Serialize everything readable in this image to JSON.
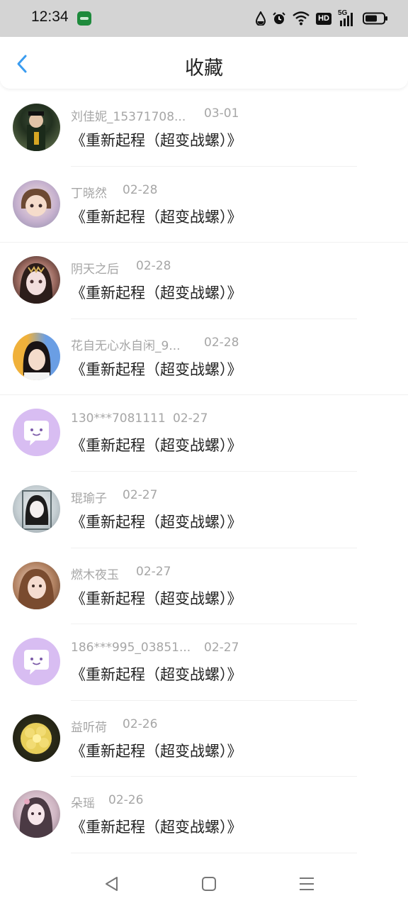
{
  "status_bar": {
    "time": "12:34",
    "icons": [
      "app-badge-icon",
      "data-drop-icon",
      "alarm-icon",
      "wifi-icon",
      "hd-icon",
      "5g-signal-icon",
      "battery-icon"
    ],
    "hd_label": "HD",
    "network_label": "5G"
  },
  "header": {
    "title": "收藏",
    "back_icon": "chevron-left-icon",
    "accent": "#3a9cf0"
  },
  "items": [
    {
      "name": "刘佳妮_15371708...",
      "date": "03-01",
      "title": "《重新起程（超变战螺）》",
      "avatar": "photo"
    },
    {
      "name": "丁晓然",
      "date": "02-28",
      "title": "《重新起程（超变战螺）》",
      "avatar": "photo"
    },
    {
      "name": "阴天之后",
      "date": "02-28",
      "title": "《重新起程（超变战螺）》",
      "avatar": "photo"
    },
    {
      "name": "花自无心水自闲_9...",
      "date": "02-28",
      "title": "《重新起程（超变战螺）》",
      "avatar": "photo"
    },
    {
      "name": "130***7081111",
      "date": "02-27",
      "title": "《重新起程（超变战螺）》",
      "avatar": "default"
    },
    {
      "name": "琨瑜子",
      "date": "02-27",
      "title": "《重新起程（超变战螺）》",
      "avatar": "photo"
    },
    {
      "name": "燃木夜玉",
      "date": "02-27",
      "title": "《重新起程（超变战螺）》",
      "avatar": "photo"
    },
    {
      "name": "186***995_03851...",
      "date": "02-27",
      "title": "《重新起程（超变战螺）》",
      "avatar": "default"
    },
    {
      "name": "益听荷",
      "date": "02-26",
      "title": "《重新起程（超变战螺）》",
      "avatar": "photo"
    },
    {
      "name": "朵瑶",
      "date": "02-26",
      "title": "《重新起程（超变战螺）》",
      "avatar": "photo"
    }
  ],
  "nav_bar": {
    "buttons": [
      "back-triangle-icon",
      "home-square-icon",
      "menu-lines-icon"
    ]
  },
  "colors": {
    "default_avatar": "#d8bdf2",
    "meta_text": "#a6a6a6",
    "title_text": "#222222"
  }
}
